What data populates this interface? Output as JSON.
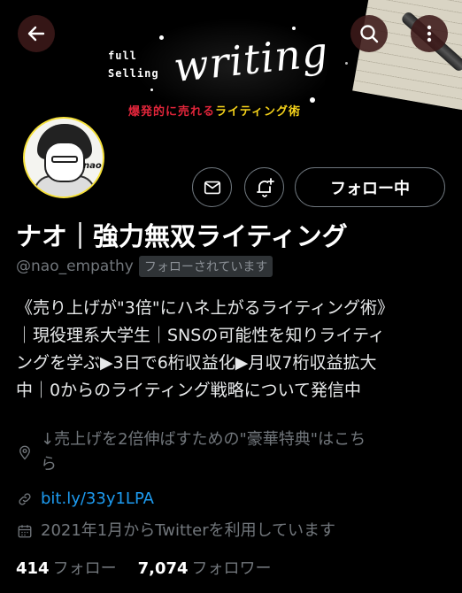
{
  "banner": {
    "line1": "full",
    "line2": "Selling",
    "script_title": "writing",
    "tagline_part1": "爆発的に売れる",
    "tagline_part2": "ライティング術"
  },
  "nav": {
    "back_icon": "arrow-left-icon",
    "search_icon": "search-icon",
    "more_icon": "more-vertical-icon"
  },
  "avatar": {
    "label": "nao"
  },
  "actions": {
    "message_icon": "envelope-icon",
    "notify_icon": "bell-plus-icon",
    "follow_label": "フォロー中"
  },
  "profile": {
    "display_name": "ナオ｜強力無双ライティング",
    "handle": "@nao_empathy",
    "follows_you": "フォローされています",
    "bio_lines": [
      "《売り上げが\"3倍\"にハネ上がるライティング術》",
      "｜現役理系大学生｜SNSの可能性を知りライティ",
      "ングを学ぶ▶3日で6桁収益化▶月収7桁収益拡大",
      "中｜0からのライティング戦略について発信中"
    ],
    "location_line1": "↓売上げを2倍伸ばすための\"豪華特典\"はこち",
    "location_line2": "ら",
    "url": "bit.ly/33y1LPA",
    "joined": "2021年1月からTwitterを利用しています"
  },
  "stats": {
    "following_count": "414",
    "following_label": "フォロー",
    "followers_count": "7,074",
    "followers_label": "フォロワー"
  }
}
